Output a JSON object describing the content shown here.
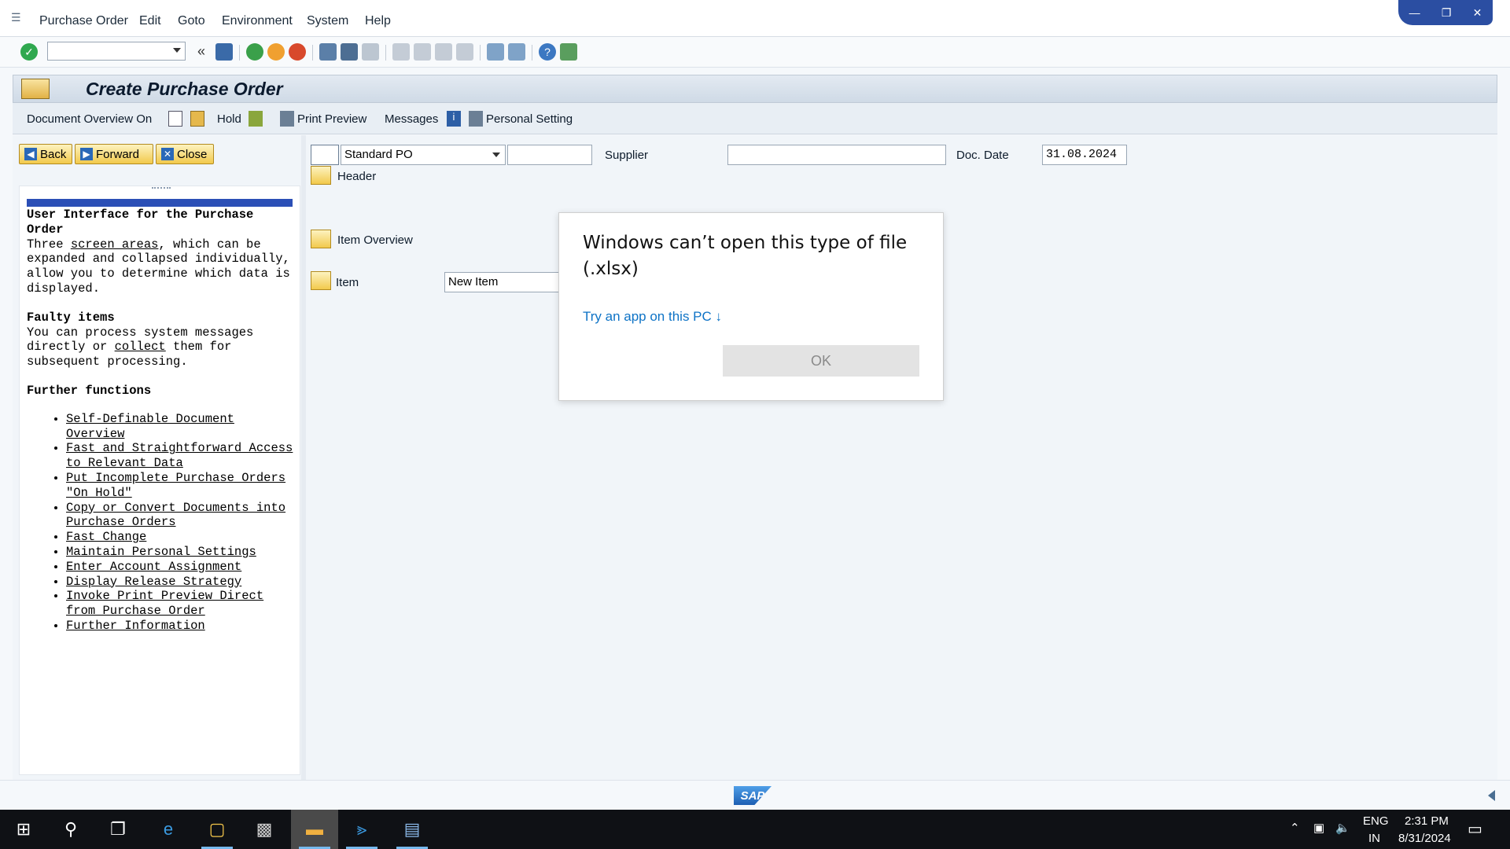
{
  "menu": {
    "items": [
      {
        "label": "Purchase Order"
      },
      {
        "label": "Edit"
      },
      {
        "label": "Goto"
      },
      {
        "label": "Environment"
      },
      {
        "label": "System"
      },
      {
        "label": "Help"
      }
    ]
  },
  "window_controls": {
    "minimize": "—",
    "restore": "❐",
    "close": "✕"
  },
  "toolbar": {
    "chevron": "«"
  },
  "title": "Create Purchase Order",
  "app_toolbar": {
    "doc_overview": "Document Overview On",
    "hold": "Hold",
    "print_preview": "Print Preview",
    "messages": "Messages",
    "personal_setting": "Personal Setting"
  },
  "nav": {
    "back": "Back",
    "forward": "Forward",
    "close": "Close"
  },
  "help": {
    "heading1": "User Interface for the Purchase Order",
    "para1_a": "Three ",
    "para1_link": "screen areas",
    "para1_b": ", which can be expanded and collapsed individually, allow you to determine which data is displayed.",
    "heading2": "Faulty items",
    "para2_a": "You can process system messages directly or ",
    "para2_link": "collect",
    "para2_b": " them for subsequent processing.",
    "heading3": "Further functions",
    "links": [
      "Self-Definable Document Overview",
      "Fast and Straightforward Access to Relevant Data",
      "Put Incomplete Purchase Orders \"On Hold\"",
      "Copy or Convert Documents into Purchase Orders",
      "Fast Change",
      "Maintain Personal Settings",
      "Enter Account Assignment",
      "Display Release Strategy",
      "Invoke Print Preview Direct from Purchase Order",
      "Further Information"
    ]
  },
  "form": {
    "order_type": "Standard PO",
    "order_number": "",
    "supplier_label": "Supplier",
    "supplier_value": "",
    "doc_date_label": "Doc. Date",
    "doc_date_value": "31.08.2024",
    "header_label": "Header",
    "item_overview_label": "Item Overview",
    "item_label": "Item",
    "item_value": "New Item"
  },
  "dialog": {
    "title": "Windows can’t open this type of file (.xlsx)",
    "link": "Try an app on this PC ↓",
    "ok": "OK"
  },
  "status": {
    "sap_logo": "SAP"
  },
  "tray": {
    "lang1": "ENG",
    "lang2": "IN",
    "time": "2:31 PM",
    "date": "8/31/2024"
  }
}
